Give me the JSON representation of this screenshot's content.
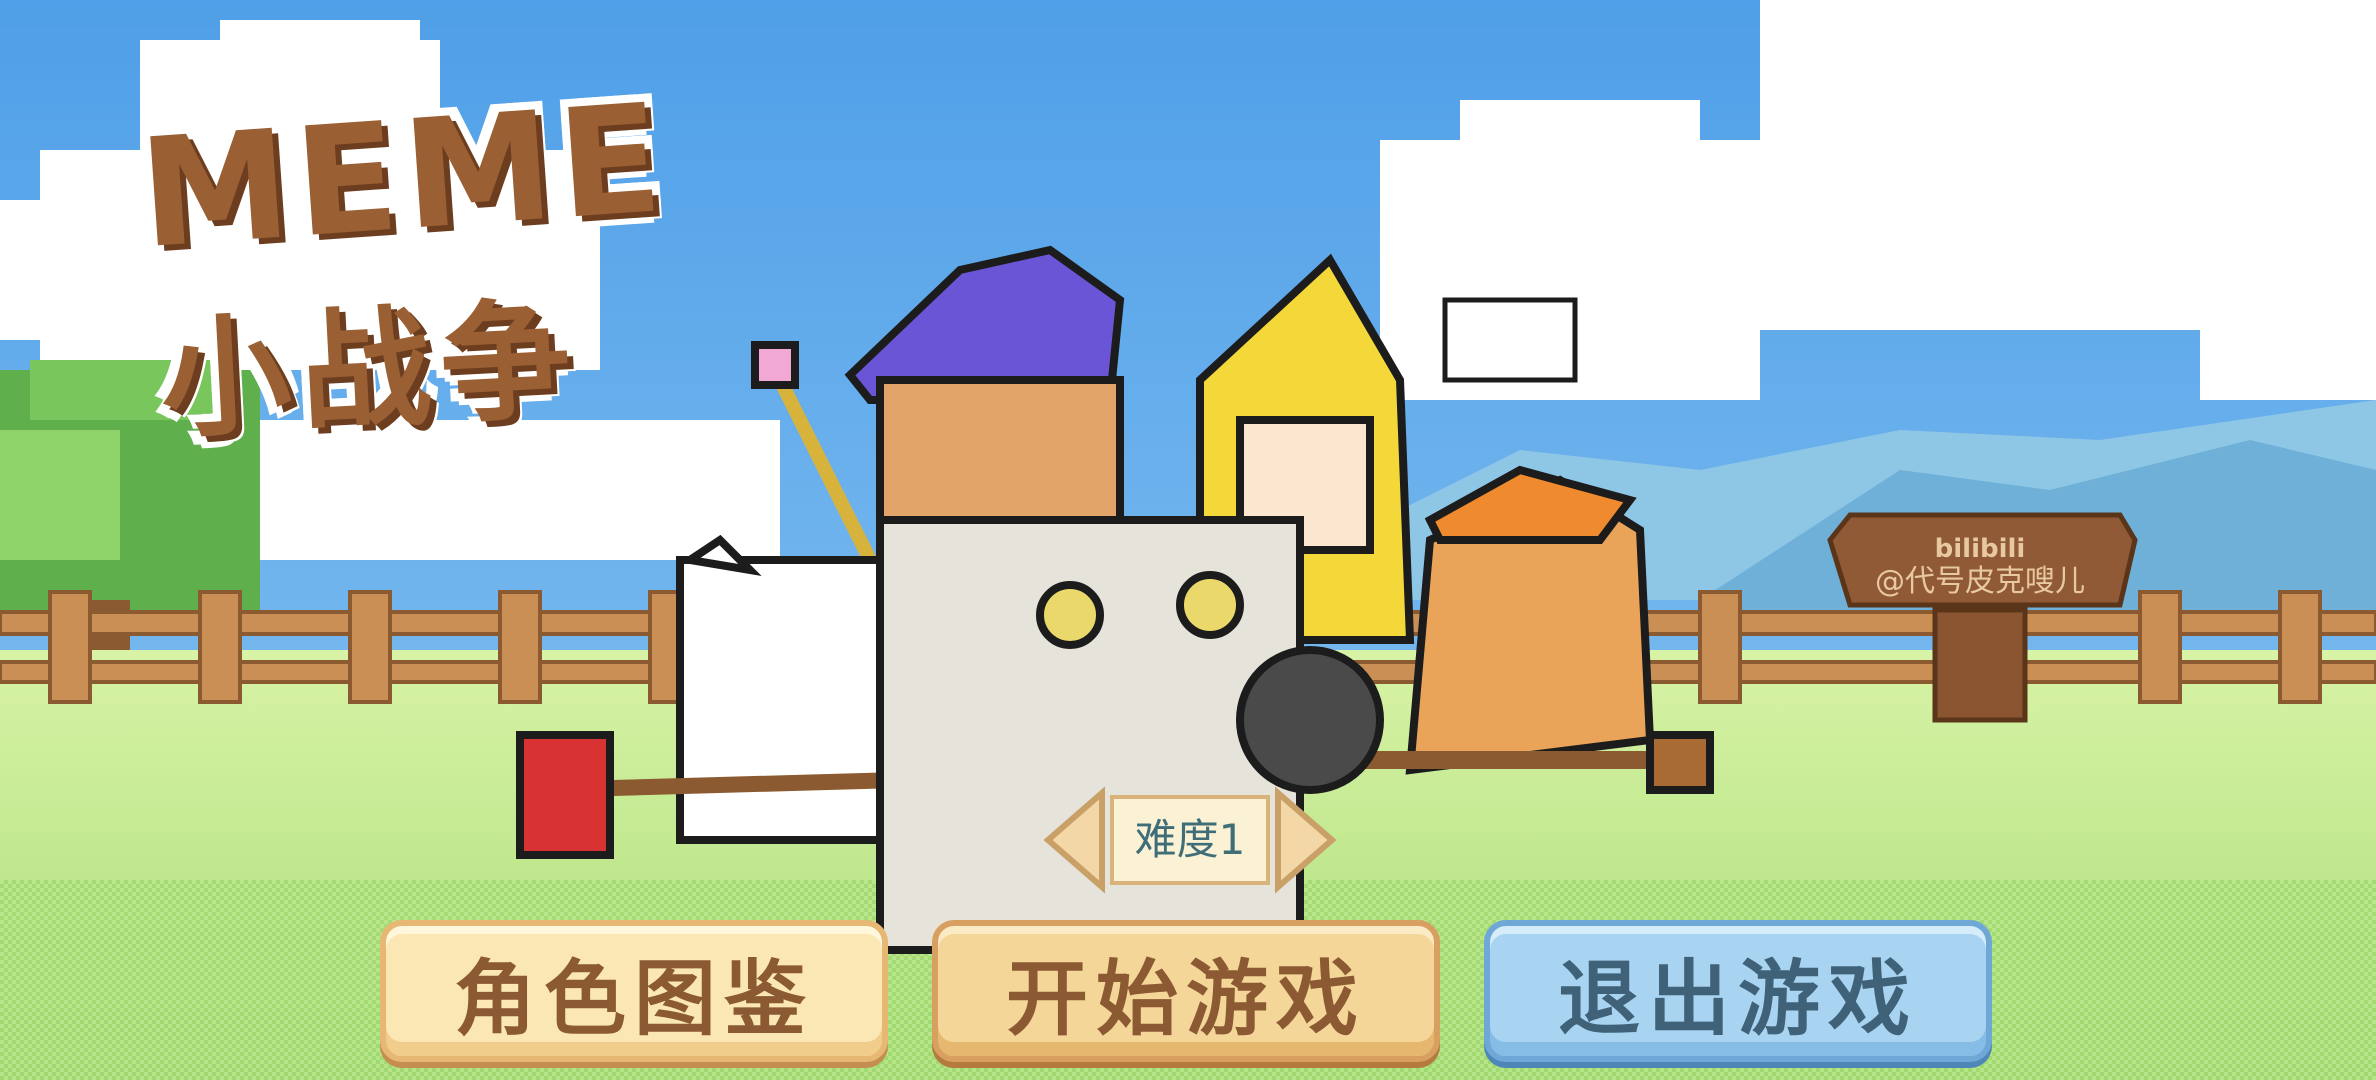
{
  "title": {
    "line1": "MEME",
    "line2": "小战争"
  },
  "signpost": {
    "brand": "bilibili",
    "account": "@代号皮克嗖儿"
  },
  "difficulty": {
    "label": "难度1"
  },
  "menu": {
    "roles_label": "角色图鉴",
    "start_label": "开始游戏",
    "quit_label": "退出游戏"
  },
  "colors": {
    "sky": "#5aa6ea",
    "grass": "#c6ec8e",
    "title_brown": "#9a5f33",
    "button_cream": "#fbe7b4",
    "button_tan": "#f5d699",
    "button_blue": "#a8d4f2"
  }
}
